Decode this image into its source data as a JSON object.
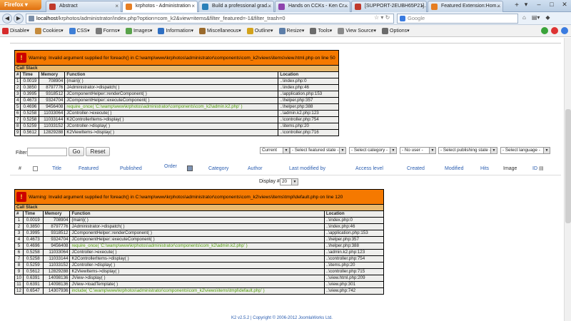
{
  "browser": {
    "app_button": "Firefox",
    "tabs": [
      {
        "title": "Abstract",
        "color": "#c0392b",
        "active": false
      },
      {
        "title": "krphotos - Administration",
        "color": "#e67e22",
        "active": true
      },
      {
        "title": "Build a professional grad...",
        "color": "#2980b9",
        "active": false
      },
      {
        "title": "Hands on CCKs - Ken Cr...",
        "color": "#8e44ad",
        "active": false
      },
      {
        "title": "[SUPPORT-2EUBH65P21]...",
        "color": "#c0392b",
        "active": false
      },
      {
        "title": "Featured Extension:Hom...",
        "color": "#e67e22",
        "active": false
      }
    ],
    "new_tab": "+",
    "url_host": "localhost",
    "url_rest": "/krphotos/administrator/index.php?option=com_k2&view=items&filter_featured=-1&filter_trash=0",
    "search_placeholder": "Google"
  },
  "devbar": {
    "items": [
      {
        "label": "Disable▾",
        "color": "#d62b2b"
      },
      {
        "label": "Cookies▾",
        "color": "#c58b3c"
      },
      {
        "label": "CSS▾",
        "color": "#3f7fd6"
      },
      {
        "label": "Forms▾",
        "color": "#7a7a7a"
      },
      {
        "label": "Images▾",
        "color": "#5aa34b"
      },
      {
        "label": "Information▾",
        "color": "#2f6fc2"
      },
      {
        "label": "Miscellaneous▾",
        "color": "#9a6a2c"
      },
      {
        "label": "Outline▾",
        "color": "#d3a21a"
      },
      {
        "label": "Resize▾",
        "color": "#5d7ea8"
      },
      {
        "label": "Tools▾",
        "color": "#6b6b6b"
      },
      {
        "label": "View Source▾",
        "color": "#8a8a8a"
      },
      {
        "label": "Options▾",
        "color": "#6b6b6b"
      }
    ]
  },
  "error1": {
    "message": "Warning: Invalid argument supplied for foreach() in C:\\wamp\\www\\krphotos\\administrator\\components\\com_k2\\views\\items\\view.html.php on line 50",
    "call_stack": "Call Stack",
    "columns": [
      "#",
      "Time",
      "Memory",
      "Function",
      "Location"
    ],
    "rows": [
      [
        "1",
        "0.0019",
        "708904",
        "{main}( )",
        "..\\index.php:0"
      ],
      [
        "2",
        "0.3850",
        "8797776",
        "JAdministrator->dispatch( )",
        "..\\index.php:46"
      ],
      [
        "3",
        "0.3995",
        "9318512",
        "JComponentHelper::renderComponent( )",
        "..\\application.php:153"
      ],
      [
        "4",
        "0.4673",
        "9324704",
        "JComponentHelper::executeComponent( )",
        "..\\helper.php:357"
      ],
      [
        "5",
        "0.4696",
        "9456408",
        "require_once( 'C:\\wamp\\www\\krphotos\\administrator\\components\\com_k2\\admin.k2.php' )",
        "..\\helper.php:388"
      ],
      [
        "6",
        "0.5258",
        "11033064",
        "JController->execute( )",
        "..\\admin.k2.php:123"
      ],
      [
        "7",
        "0.5258",
        "11033144",
        "K2ControllerItems->display( )",
        "..\\controller.php:754"
      ],
      [
        "8",
        "0.5259",
        "11033152",
        "JController->display( )",
        "..\\items.php:20"
      ],
      [
        "9",
        "0.5612",
        "12829288",
        "K2ViewItems->display( )",
        "..\\controller.php:716"
      ]
    ]
  },
  "filter": {
    "label": "Filter",
    "go": "Go",
    "reset": "Reset",
    "selects": [
      "Current",
      "- Select featured state -",
      "- Select category -",
      "- No user -",
      "- Select publishing state -",
      "- Select language -"
    ]
  },
  "columns_header": [
    "#",
    "Title",
    "Featured",
    "Published",
    "Order",
    "Category",
    "Author",
    "Last modified by",
    "Access level",
    "Created",
    "Modified",
    "Hits",
    "Image",
    "ID"
  ],
  "display": {
    "label": "Display #",
    "value": "20"
  },
  "error2": {
    "message": "Warning: Invalid argument supplied for foreach() in C:\\wamp\\www\\krphotos\\administrator\\components\\com_k2\\views\\items\\tmpl\\default.php on line 120",
    "call_stack": "Call Stack",
    "columns": [
      "#",
      "Time",
      "Memory",
      "Function",
      "Location"
    ],
    "rows": [
      [
        "1",
        "0.0019",
        "708904",
        "{main}( )",
        "..\\index.php:0"
      ],
      [
        "2",
        "0.3850",
        "8797776",
        "JAdministrator->dispatch( )",
        "..\\index.php:46"
      ],
      [
        "3",
        "0.3995",
        "9318512",
        "JComponentHelper::renderComponent( )",
        "..\\application.php:153"
      ],
      [
        "4",
        "0.4673",
        "9324704",
        "JComponentHelper::executeComponent( )",
        "..\\helper.php:357"
      ],
      [
        "5",
        "0.4696",
        "9456408",
        "require_once( 'C:\\wamp\\www\\krphotos\\administrator\\components\\com_k2\\admin.k2.php' )",
        "..\\helper.php:388"
      ],
      [
        "6",
        "0.5258",
        "11033064",
        "JController->execute( )",
        "..\\admin.k2.php:123"
      ],
      [
        "7",
        "0.5258",
        "11033144",
        "K2ControllerItems->display( )",
        "..\\controller.php:754"
      ],
      [
        "8",
        "0.5259",
        "11033152",
        "JController->display( )",
        "..\\items.php:20"
      ],
      [
        "9",
        "0.5612",
        "12829288",
        "K2ViewItems->display( )",
        "..\\controller.php:715"
      ],
      [
        "10",
        "0.6391",
        "14098136",
        "JView->display( )",
        "..\\view.html.php:209"
      ],
      [
        "11",
        "0.6391",
        "14098136",
        "JView->loadTemplate( )",
        "..\\view.php:301"
      ],
      [
        "12",
        "0.6547",
        "14307936",
        "include( 'C:\\wamp\\www\\krphotos\\administrator\\components\\com_k2\\views\\items\\tmpl\\default.php' )",
        "..\\view.php:742"
      ]
    ]
  },
  "footer": {
    "text": "K2 v2.5.2 | Copyright © 2006-2012 JoomlaWorks Ltd."
  }
}
